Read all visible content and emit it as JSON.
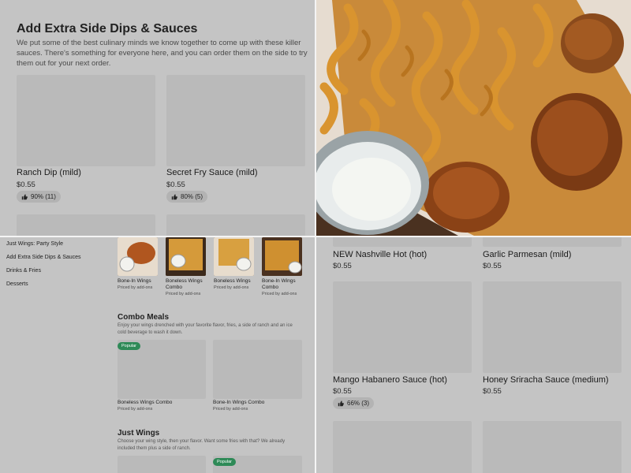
{
  "extra_dips": {
    "title": "Add Extra Side Dips & Sauces",
    "description": "We put some of the best culinary minds we know together to come up with these killer sauces. There's something for everyone here, and you can order them on the side to try them out for your next order.",
    "items": [
      {
        "name": "Ranch Dip (mild)",
        "price": "$0.55",
        "rating": "90% (11)"
      },
      {
        "name": "Secret Fry Sauce (mild)",
        "price": "$0.55",
        "rating": "80% (5)"
      }
    ]
  },
  "sidebar": {
    "items": [
      {
        "label": "Just Wings: Party Style"
      },
      {
        "label": "Add Extra Side Dips & Sauces"
      },
      {
        "label": "Drinks & Fries"
      },
      {
        "label": "Desserts"
      }
    ]
  },
  "popular_row": {
    "items": [
      {
        "name": "Bone-In Wings",
        "sub": "Priced by add-ons"
      },
      {
        "name": "Boneless Wings Combo",
        "sub": "Priced by add-ons"
      },
      {
        "name": "Boneless Wings",
        "sub": "Priced by add-ons"
      },
      {
        "name": "Bone-In Wings Combo",
        "sub": "Priced by add-ons"
      }
    ]
  },
  "combo_meals": {
    "title": "Combo Meals",
    "description": "Enjoy your wings drenched with your favorite flavor, fries, a side of ranch and an ice cold beverage to wash it down.",
    "badge": "Popular",
    "items": [
      {
        "name": "Boneless Wings Combo",
        "sub": "Priced by add-ons"
      },
      {
        "name": "Bone-In Wings Combo",
        "sub": "Priced by add-ons"
      }
    ]
  },
  "just_wings": {
    "title": "Just Wings",
    "description": "Choose your wing style, then your flavor. Want some fries with that? We already included them plus a side of ranch.",
    "badge": "Popular"
  },
  "sauces": {
    "items": [
      {
        "name": "NEW Nashville Hot (hot)",
        "price": "$0.55"
      },
      {
        "name": "Garlic Parmesan (mild)",
        "price": "$0.55"
      },
      {
        "name": "Mango Habanero Sauce (hot)",
        "price": "$0.55",
        "rating": "66% (3)"
      },
      {
        "name": "Honey Sriracha Sauce (medium)",
        "price": "$0.55"
      }
    ]
  },
  "icons": {
    "rating": "thumbs-up-icon"
  },
  "colors": {
    "popular_badge": "#2e8a57",
    "placeholder": "#bababa"
  }
}
